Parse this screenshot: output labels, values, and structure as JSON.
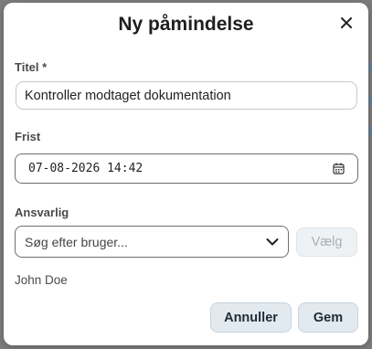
{
  "dialog": {
    "title": "Ny påmindelse",
    "close_icon": "close-icon"
  },
  "title_field": {
    "label": "Titel *",
    "value": "Kontroller modtaget dokumentation"
  },
  "deadline_field": {
    "label": "Frist",
    "value": "07-08-2026 14:42",
    "icon": "calendar-icon"
  },
  "responsible_field": {
    "label": "Ansvarlig",
    "placeholder": "Søg efter bruger...",
    "dropdown_icon": "chevron-down-icon",
    "choose_label": "Vælg",
    "selected_user": "John Doe"
  },
  "footer": {
    "cancel_label": "Annuller",
    "save_label": "Gem"
  },
  "colors": {
    "overlay": "#7d7d7d",
    "dialog_bg": "#ffffff",
    "button_bg": "#e2eaf0",
    "disabled_text": "#a7afb6"
  }
}
